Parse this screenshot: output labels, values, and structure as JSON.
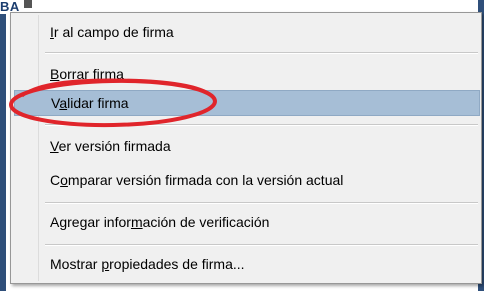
{
  "background": {
    "title_fragment": "BA"
  },
  "menu": {
    "items": [
      {
        "pre": "",
        "acc": "I",
        "post": "r al campo de firma"
      },
      {
        "pre": "",
        "acc": "B",
        "post": "orrar firma"
      },
      {
        "pre": "V",
        "acc": "a",
        "post": "lidar firma"
      },
      {
        "pre": "",
        "acc": "V",
        "post": "er versión firmada"
      },
      {
        "pre": "C",
        "acc": "o",
        "post": "mparar versión firmada con la versión actual"
      },
      {
        "pre": "Agregar infor",
        "acc": "m",
        "post": "ación de verificación"
      },
      {
        "pre": "Mostrar ",
        "acc": "p",
        "post": "ropiedades de firma..."
      }
    ],
    "highlighted_index": 2
  },
  "colors": {
    "highlight": "#a6bed6",
    "annotation": "#e0252b"
  }
}
